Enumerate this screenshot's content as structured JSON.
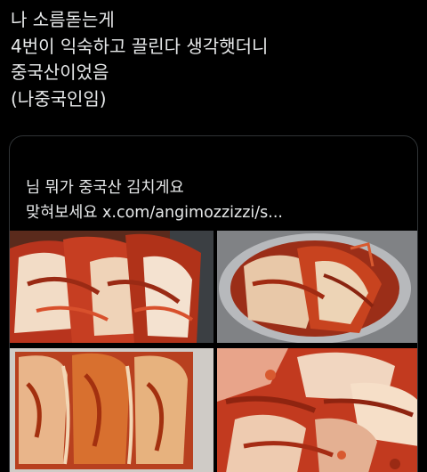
{
  "tweet": {
    "lines": [
      "나 소름돋는게",
      "4번이 익숙하고 끌린다 생각햇더니",
      "중국산이었음",
      "(나중국인임)"
    ]
  },
  "quoted_tweet": {
    "text_line1": "님 뭐가 중국산 김치게요",
    "text_line2": "맞혀보세요 x.com/angimozzizzi/s...",
    "photos": [
      {
        "icon": "kimchi-photo-icon"
      },
      {
        "icon": "kimchi-bowl-photo-icon"
      },
      {
        "icon": "kimchi-container-photo-icon"
      },
      {
        "icon": "kimchi-closeup-photo-icon"
      }
    ]
  },
  "colors": {
    "background": "#000000",
    "text": "#e7e9ea",
    "card_border": "#2f3336",
    "kimchi_red": "#c23a1f",
    "cabbage": "#f0d9c0"
  }
}
